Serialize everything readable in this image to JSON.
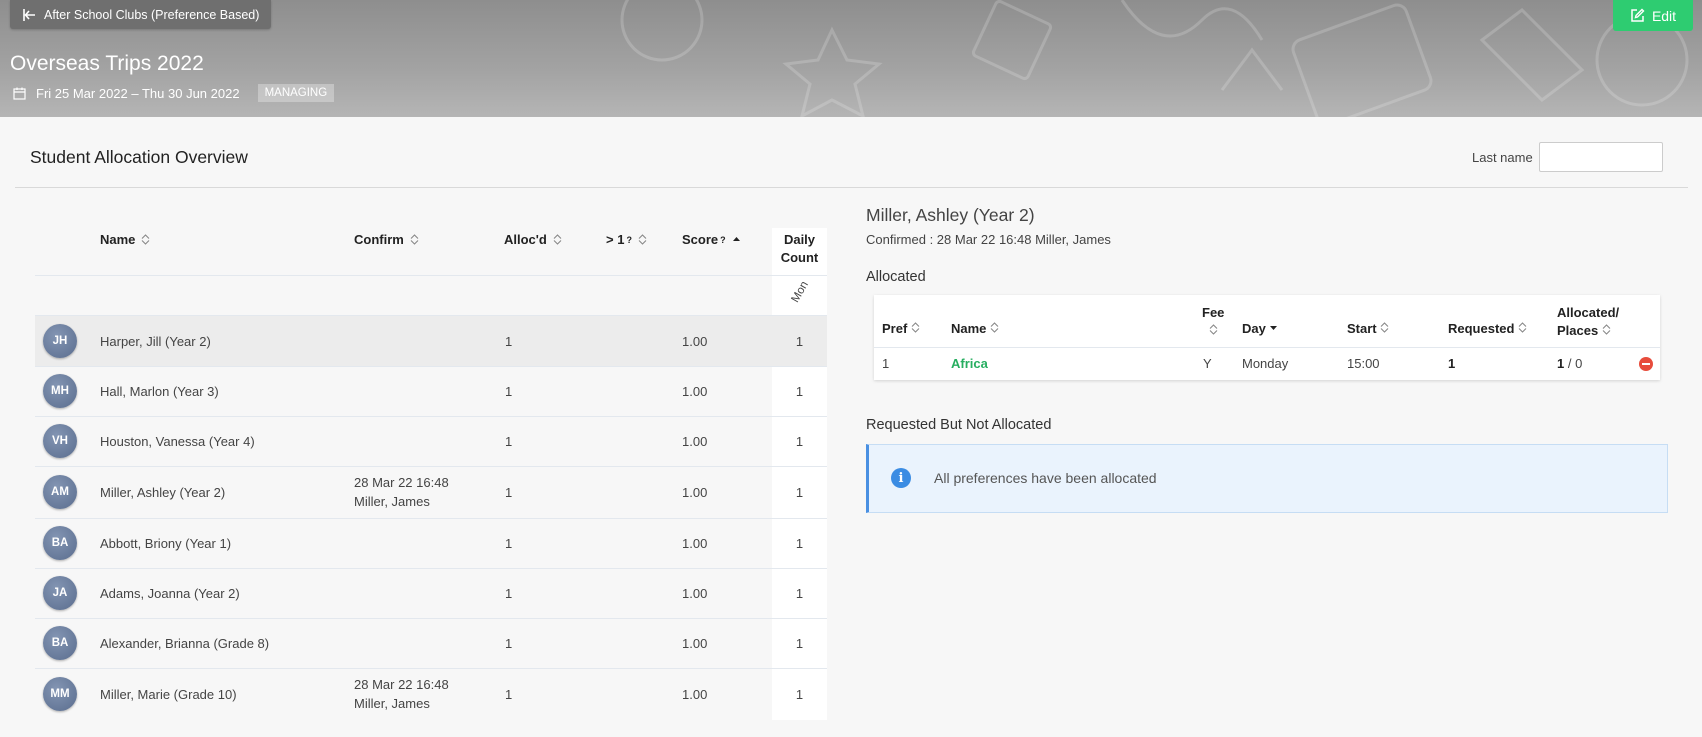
{
  "header": {
    "back_label": "After School Clubs (Preference Based)",
    "edit_label": "Edit",
    "title": "Overseas Trips 2022",
    "date_range": "Fri 25 Mar 2022 – Thu 30 Jun 2022",
    "status_badge": "MANAGING"
  },
  "overview": {
    "title": "Student Allocation Overview",
    "filter_label": "Last name",
    "filter_value": ""
  },
  "students_table": {
    "headers": {
      "name": "Name",
      "confirm": "Confirm",
      "allocd": "Alloc'd",
      "gt1": "> 1",
      "gt1_help": "?",
      "score": "Score",
      "score_help": "?",
      "daily_line1": "Daily",
      "daily_line2": "Count",
      "day": "Mon"
    },
    "rows": [
      {
        "initials": "JH",
        "name": "Harper, Jill (Year 2)",
        "confirm_date": "",
        "confirm_by": "",
        "allocd": "1",
        "score": "1.00",
        "mon": "1"
      },
      {
        "initials": "MH",
        "name": "Hall, Marlon (Year 3)",
        "confirm_date": "",
        "confirm_by": "",
        "allocd": "1",
        "score": "1.00",
        "mon": "1"
      },
      {
        "initials": "VH",
        "name": "Houston, Vanessa (Year 4)",
        "confirm_date": "",
        "confirm_by": "",
        "allocd": "1",
        "score": "1.00",
        "mon": "1"
      },
      {
        "initials": "AM",
        "name": "Miller, Ashley (Year 2)",
        "confirm_date": "28 Mar 22 16:48",
        "confirm_by": "Miller, James",
        "allocd": "1",
        "score": "1.00",
        "mon": "1"
      },
      {
        "initials": "BA",
        "name": "Abbott, Briony (Year 1)",
        "confirm_date": "",
        "confirm_by": "",
        "allocd": "1",
        "score": "1.00",
        "mon": "1"
      },
      {
        "initials": "JA",
        "name": "Adams, Joanna (Year 2)",
        "confirm_date": "",
        "confirm_by": "",
        "allocd": "1",
        "score": "1.00",
        "mon": "1"
      },
      {
        "initials": "BA",
        "name": "Alexander, Brianna (Grade 8)",
        "confirm_date": "",
        "confirm_by": "",
        "allocd": "1",
        "score": "1.00",
        "mon": "1"
      },
      {
        "initials": "MM",
        "name": "Miller, Marie (Grade 10)",
        "confirm_date": "28 Mar 22 16:48",
        "confirm_by": "Miller, James",
        "allocd": "1",
        "score": "1.00",
        "mon": "1"
      }
    ]
  },
  "detail": {
    "student_name": "Miller, Ashley (Year 2)",
    "confirmed_text": "Confirmed : 28 Mar 22 16:48 Miller, James",
    "allocated_title": "Allocated",
    "alloc_headers": {
      "pref": "Pref",
      "name": "Name",
      "fee": "Fee",
      "day": "Day",
      "start": "Start",
      "requested": "Requested",
      "alloc_line1": "Allocated/",
      "alloc_line2": "Places"
    },
    "alloc_rows": [
      {
        "pref": "1",
        "name": "Africa",
        "fee": "Y",
        "day": "Monday",
        "start": "15:00",
        "requested": "1",
        "allocated": "1",
        "places": "/ 0"
      }
    ],
    "not_allocated_title": "Requested But Not Allocated",
    "info_message": "All preferences have been allocated"
  },
  "colors": {
    "accent_green": "#2ecc71",
    "link_green": "#27ae60",
    "info_blue": "#3b8ce3",
    "remove_red": "#e74c3c"
  }
}
